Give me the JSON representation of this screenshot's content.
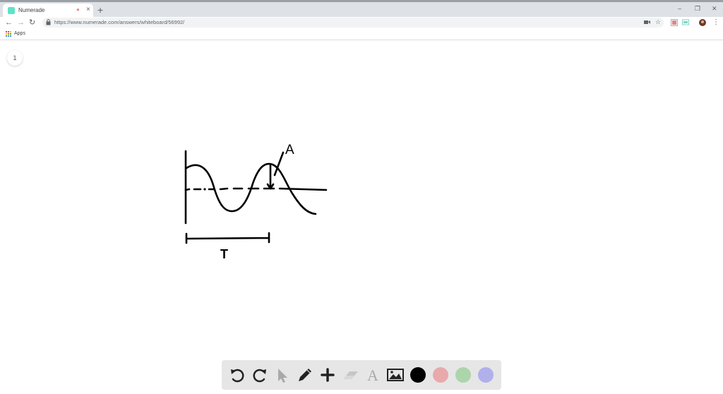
{
  "browser": {
    "tab_title": "Numerade",
    "tab_close": "×",
    "new_tab": "+",
    "url": "https://www.numerade.com/answers/whiteboard/56992/",
    "bookmarks": {
      "apps_label": "Apps"
    },
    "window_controls": [
      "–",
      "❐",
      "✕"
    ]
  },
  "whiteboard": {
    "page_number": "1",
    "labels": {
      "amplitude": "A",
      "period": "T"
    }
  },
  "toolbar": {
    "tools": [
      "undo-icon",
      "redo-icon",
      "pointer-icon",
      "pen-icon",
      "add-icon",
      "eraser-icon",
      "text-icon",
      "image-icon"
    ],
    "colors": [
      "#000000",
      "#e8a9ab",
      "#acd5ab",
      "#b1b0ec"
    ]
  },
  "colors": {
    "accent": "#5fe3c8",
    "toolbar_bg": "#e6e6e6"
  }
}
